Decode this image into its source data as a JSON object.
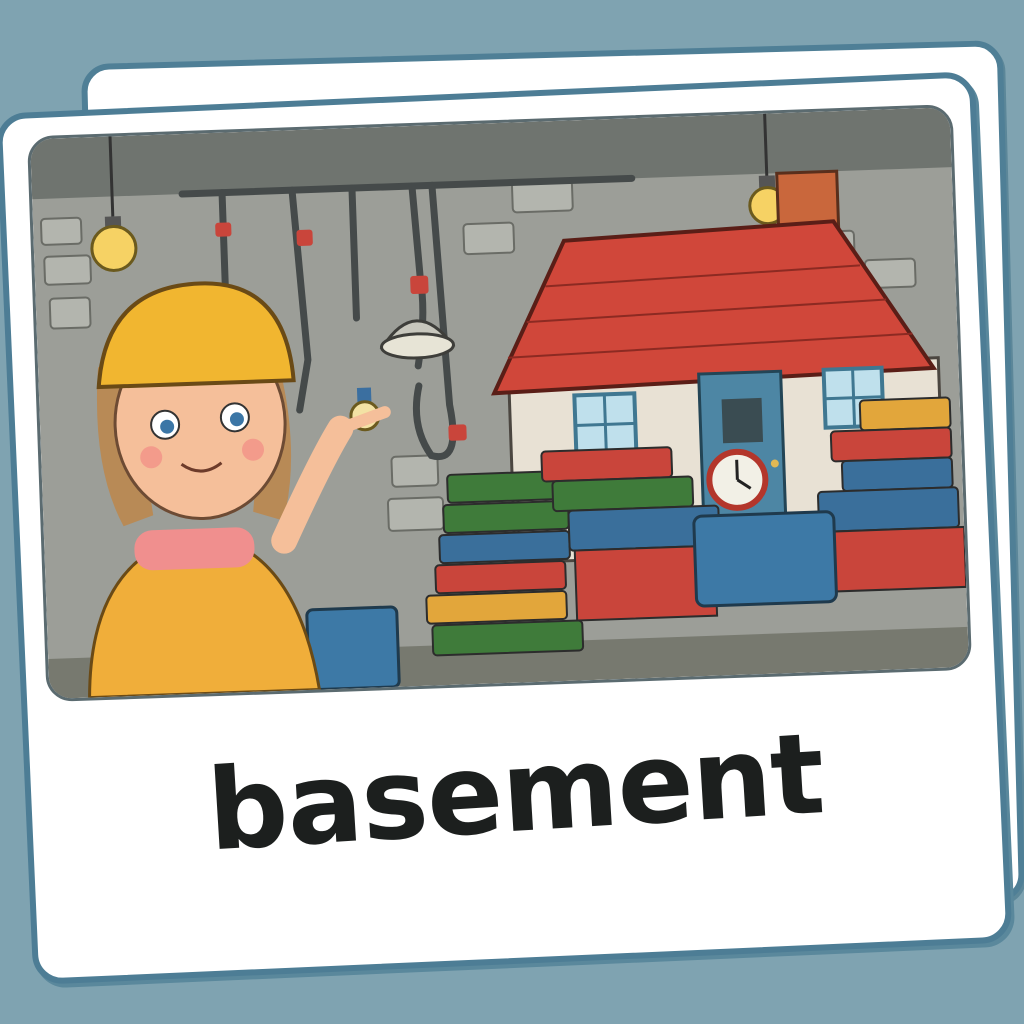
{
  "flashcard": {
    "word": "basement",
    "frame_color": "#4d7d95",
    "background_color": "#7fa3b1",
    "text_color": "#1c1f1e"
  },
  "scene": {
    "icons": [
      "girl-in-hard-hat",
      "toy-house",
      "book-stack",
      "alarm-clock",
      "light-bulb",
      "pipes",
      "storage-box"
    ]
  }
}
